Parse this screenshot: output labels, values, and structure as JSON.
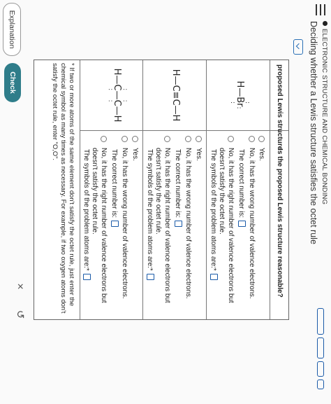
{
  "header": {
    "topic": "ELECTRONIC STRUCTURE AND CHEMICAL BONDING",
    "title": "Deciding whether a Lewis structure satisfies the octet rule"
  },
  "table": {
    "col1_header": "proposed Lewis structure",
    "col2_header": "Is the proposed Lewis structure reasonable?",
    "rows": [
      {
        "structure": {
          "left": "H",
          "bond": "—",
          "right": "Br",
          "dots_top": ":",
          "dots_bottom": ":",
          "dots_right": ":"
        },
        "yes": "Yes.",
        "wrong_count": "No, it has the wrong number of valence electrons.",
        "correct_number": "The correct number is:",
        "right_count": "No, it has the right number of valence electrons but doesn't satisfy the octet rule.",
        "symbols": "The symbols of the problem atoms are:*"
      },
      {
        "structure": {
          "left": "H",
          "bond1": "—",
          "mid": "C",
          "triple": "≡",
          "c2": "C",
          "bond2": "—",
          "right": "H"
        },
        "yes": "Yes.",
        "wrong_count": "No, it has the wrong number of valence electrons.",
        "correct_number": "The correct number is:",
        "right_count": "No, it has the right number of valence electrons but doesn't satisfy the octet rule.",
        "symbols": "The symbols of the problem atoms are:*"
      },
      {
        "structure": {
          "h1": "H",
          "b1": "—",
          "c1": "C",
          "b2": "—",
          "c2": "C",
          "b3": "—",
          "h2": "H",
          "dots": "∶"
        },
        "yes": "Yes.",
        "wrong_count": "No, it has the wrong number of valence electrons.",
        "correct_number": "The correct number is:",
        "right_count": "No, it has the right number of valence electrons but doesn't satisfy the octet rule.",
        "symbols": "The symbols of the problem atoms are:*"
      }
    ],
    "footnote": "* If two or more atoms of the same element don't satisfy the octet rule, just enter the chemical symbol as many times as necessary. For example, if two oxygen atoms don't satisfy the octet rule, enter \"O,O\"."
  },
  "actions": {
    "clear": "×",
    "undo": "↺",
    "explanation": "Explanation",
    "check": "Check"
  },
  "icons": {
    "menu": "hamburger-menu-icon",
    "collapse": "chevron-down-icon",
    "clear": "x-icon",
    "undo": "undo-icon"
  },
  "colors": {
    "accent": "#1a5aa8",
    "check_button": "#2f7d8a"
  }
}
